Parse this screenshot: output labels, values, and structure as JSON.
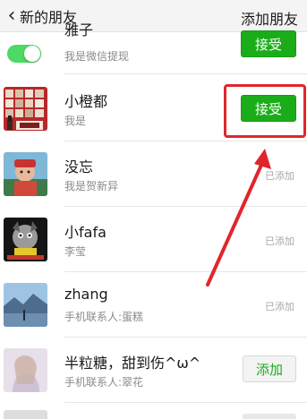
{
  "header": {
    "back_icon": "chevron-left-icon",
    "title": "新的朋友",
    "action_label": "添加朋友"
  },
  "rows": [
    {
      "name": "雅子",
      "message": "我是微信提现",
      "action": "接受",
      "avatar": "toggle-switch"
    },
    {
      "name": "小橙都",
      "message": "我是",
      "action": "接受",
      "avatar": "group-photo"
    },
    {
      "name": "没忘",
      "message": "我是贺新异",
      "status": "已添加",
      "avatar": "child-photo"
    },
    {
      "name": "小fafa",
      "message": "李莹",
      "status": "已添加",
      "avatar": "cartoon-dog"
    },
    {
      "name": "zhang",
      "message": "手机联系人:蛋糕",
      "status": "已添加",
      "avatar": "landscape-photo"
    },
    {
      "name": "半粒糖，甜到伤^ω^",
      "message": "手机联系人:翠花",
      "action": "添加",
      "avatar": "portrait-photo"
    }
  ],
  "colors": {
    "accept_green": "#1aad19",
    "highlight_red": "#e0262b"
  }
}
